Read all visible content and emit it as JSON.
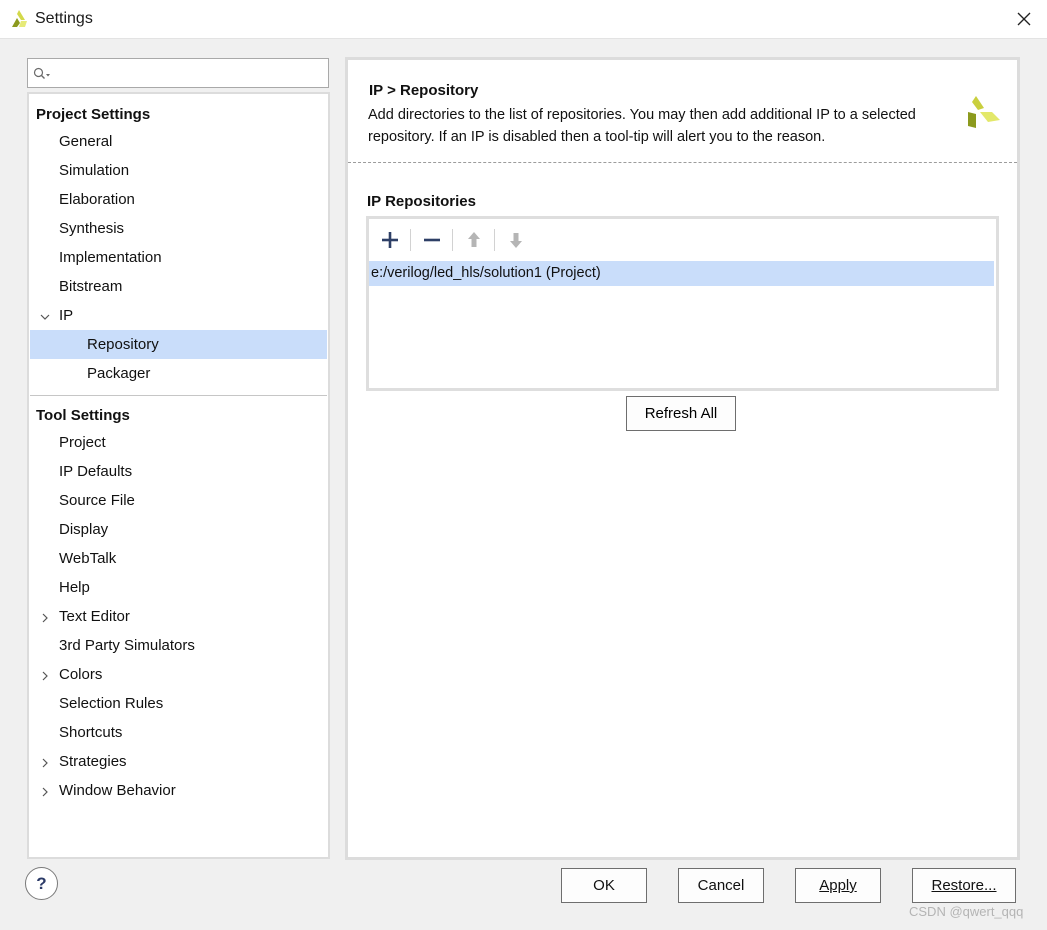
{
  "window": {
    "title": "Settings"
  },
  "search": {
    "value": "",
    "placeholder": ""
  },
  "nav": {
    "project_settings_label": "Project Settings",
    "project_items": [
      "General",
      "Simulation",
      "Elaboration",
      "Synthesis",
      "Implementation",
      "Bitstream"
    ],
    "ip_label": "IP",
    "ip_children": [
      "Repository",
      "Packager"
    ],
    "selected": "Repository",
    "tool_settings_label": "Tool Settings",
    "tool_items": [
      "Project",
      "IP Defaults",
      "Source File",
      "Display",
      "WebTalk",
      "Help",
      "Text Editor",
      "3rd Party Simulators",
      "Colors",
      "Selection Rules",
      "Shortcuts",
      "Strategies",
      "Window Behavior"
    ],
    "expandable_tool_items": [
      "Text Editor",
      "Colors",
      "Strategies",
      "Window Behavior"
    ]
  },
  "panel": {
    "title": "IP > Repository",
    "description": "Add directories to the list of repositories. You may then add additional IP to a selected repository. If an IP is disabled then a tool-tip will alert you to the reason.",
    "section_title": "IP Repositories",
    "toolbar": [
      "add-icon",
      "remove-icon",
      "move-up-icon",
      "move-down-icon"
    ],
    "repositories": [
      "e:/verilog/led_hls/solution1 (Project)"
    ],
    "refresh_label": "Refresh All"
  },
  "footer": {
    "help_label": "?",
    "ok_label": "OK",
    "cancel_label": "Cancel",
    "apply_label": "Apply",
    "restore_label": "Restore..."
  },
  "watermark": "CSDN @qwert_qqq",
  "colors": {
    "selection": "#c9ddfa",
    "brand_light": "#e3e86a",
    "brand_dark": "#8c9a1e"
  }
}
